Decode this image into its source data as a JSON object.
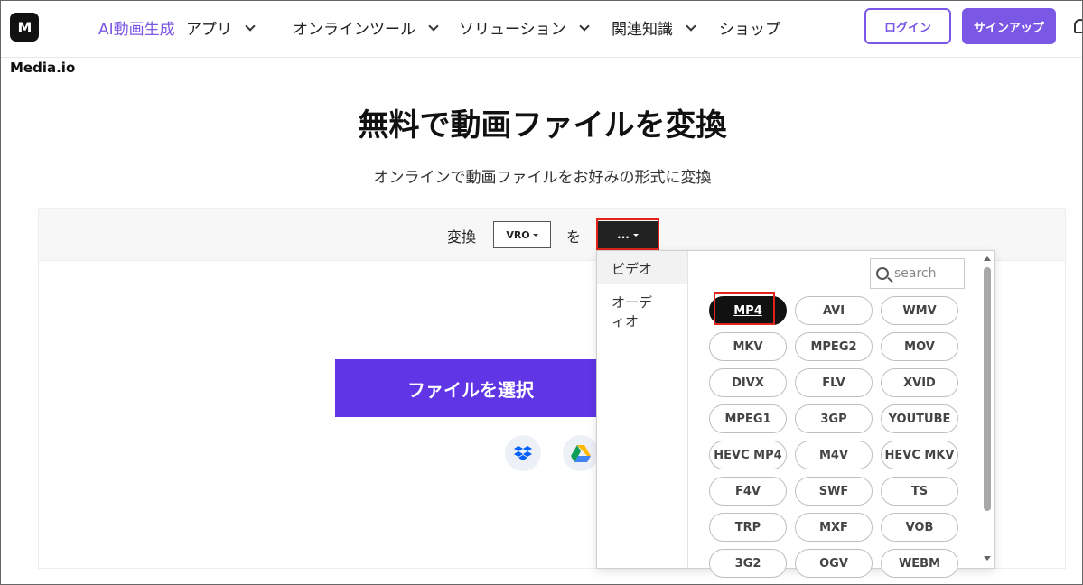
{
  "nav": {
    "logo_text": "M",
    "items": [
      {
        "label": "AI動画生成",
        "accent": true
      },
      {
        "label": "アプリ"
      },
      {
        "label": "オンラインツール"
      },
      {
        "label": "ソリューション"
      },
      {
        "label": "関連知識"
      },
      {
        "label": "ショップ"
      }
    ],
    "login_label": "ログイン",
    "signup_label": "サインアップ"
  },
  "brand": "Media.io",
  "hero": {
    "title": "無料で動画ファイルを変換",
    "subtitle": "オンラインで動画ファイルをお好みの形式に変換"
  },
  "converter": {
    "convert_label": "変換",
    "from_value": "VRO",
    "to_label": "を",
    "to_value": "...",
    "choose_button": "ファイルを選択"
  },
  "dropdown": {
    "categories": [
      "ビデオ",
      "オーディオ"
    ],
    "search_placeholder": "search",
    "formats": [
      "MP4",
      "AVI",
      "WMV",
      "MKV",
      "MPEG2",
      "MOV",
      "DIVX",
      "FLV",
      "XVID",
      "MPEG1",
      "3GP",
      "YOUTUBE",
      "HEVC MP4",
      "M4V",
      "HEVC MKV",
      "F4V",
      "SWF",
      "TS",
      "TRP",
      "MXF",
      "VOB",
      "3G2",
      "OGV",
      "WEBM"
    ],
    "selected_format": "MP4"
  },
  "colors": {
    "accent": "#7b57e6",
    "primary_button": "#6035e6",
    "highlight": "#e0241b"
  },
  "icons": [
    "dropbox-icon",
    "google-drive-icon",
    "search-icon",
    "chevron-down-icon",
    "bell-icon"
  ]
}
